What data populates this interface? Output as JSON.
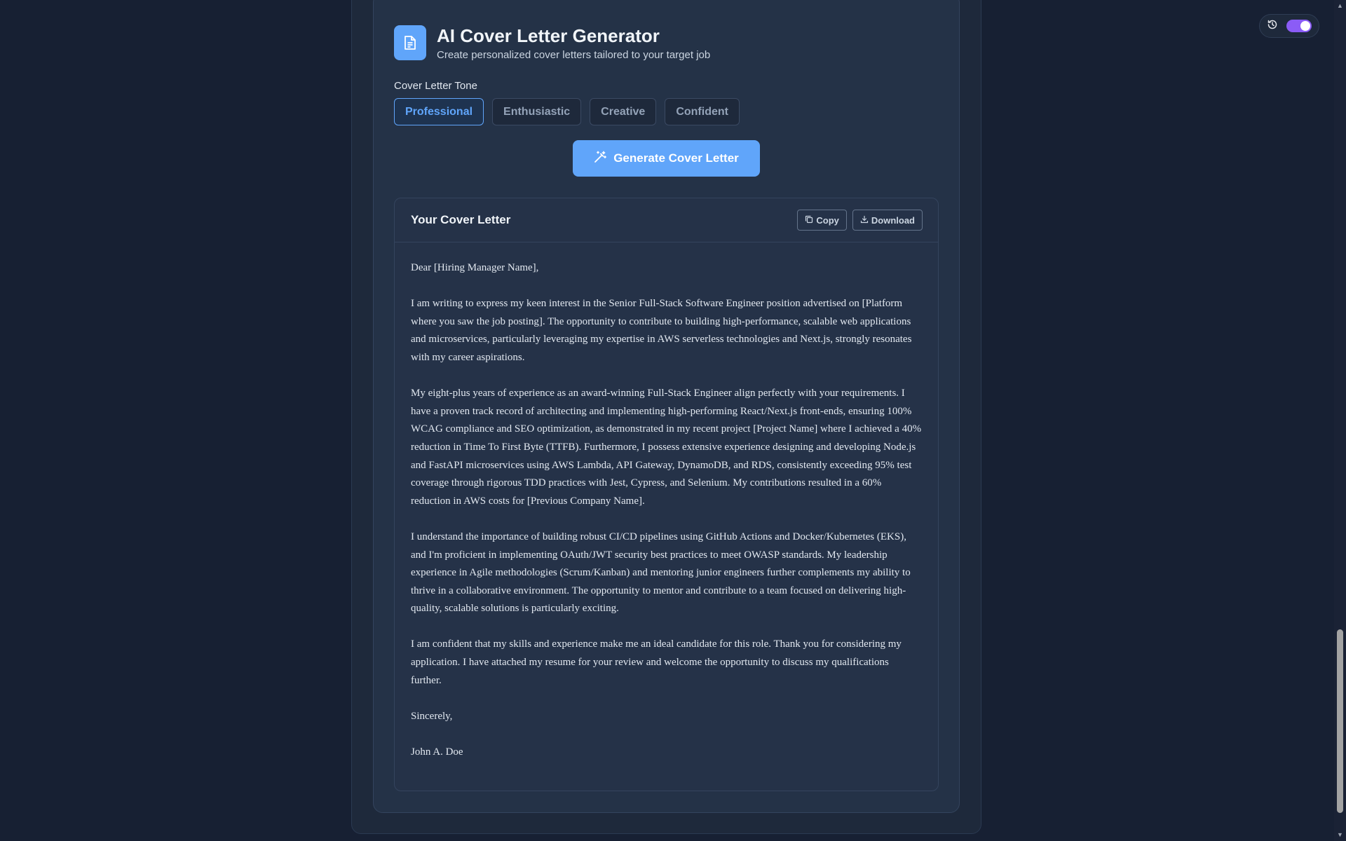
{
  "app": {
    "title": "AI Cover Letter Generator",
    "subtitle": "Create personalized cover letters tailored to your target job",
    "icon": "document-icon"
  },
  "tone": {
    "label": "Cover Letter Tone",
    "options": [
      "Professional",
      "Enthusiastic",
      "Creative",
      "Confident"
    ],
    "selected": "Professional"
  },
  "generate_button": {
    "label": "Generate Cover Letter",
    "icon": "magic-wand-icon"
  },
  "output": {
    "title": "Your Cover Letter",
    "copy_label": "Copy",
    "download_label": "Download",
    "letter": [
      "Dear [Hiring Manager Name],",
      "I am writing to express my keen interest in the Senior Full-Stack Software Engineer position advertised on [Platform where you saw the job posting].  The opportunity to contribute to building high-performance, scalable web applications and microservices, particularly leveraging my expertise in AWS serverless technologies and Next.js, strongly resonates with my career aspirations.",
      "My eight-plus years of experience as an award-winning Full-Stack Engineer align perfectly with your requirements.  I have a proven track record of architecting and implementing high-performing React/Next.js front-ends, ensuring 100% WCAG compliance and SEO optimization, as demonstrated in my recent project [Project Name] where I achieved a 40% reduction in Time To First Byte (TTFB).  Furthermore, I possess extensive experience designing and developing Node.js and FastAPI microservices using AWS Lambda, API Gateway, DynamoDB, and RDS, consistently exceeding 95% test coverage through rigorous TDD practices with Jest, Cypress, and Selenium.  My contributions resulted in a 60% reduction in AWS costs for [Previous Company Name].",
      "I understand the importance of building robust CI/CD pipelines using GitHub Actions and Docker/Kubernetes (EKS), and I'm proficient in implementing OAuth/JWT security best practices to meet OWASP standards.  My leadership experience in Agile methodologies (Scrum/Kanban) and mentoring junior engineers further complements my ability to thrive in a collaborative environment.  The opportunity to mentor and contribute to a team focused on delivering high-quality, scalable solutions is particularly exciting.",
      "I am confident that my skills and experience make me an ideal candidate for this role.  Thank you for considering my application. I have attached my resume for your review and welcome the opportunity to discuss my qualifications further.",
      "Sincerely,",
      "John A. Doe"
    ]
  },
  "theme_toggle": {
    "on": true,
    "accent": "#8b5cf6",
    "icon": "history-icon"
  },
  "colors": {
    "accent": "#60a5fa",
    "background": "#172033",
    "card": "#243247"
  }
}
